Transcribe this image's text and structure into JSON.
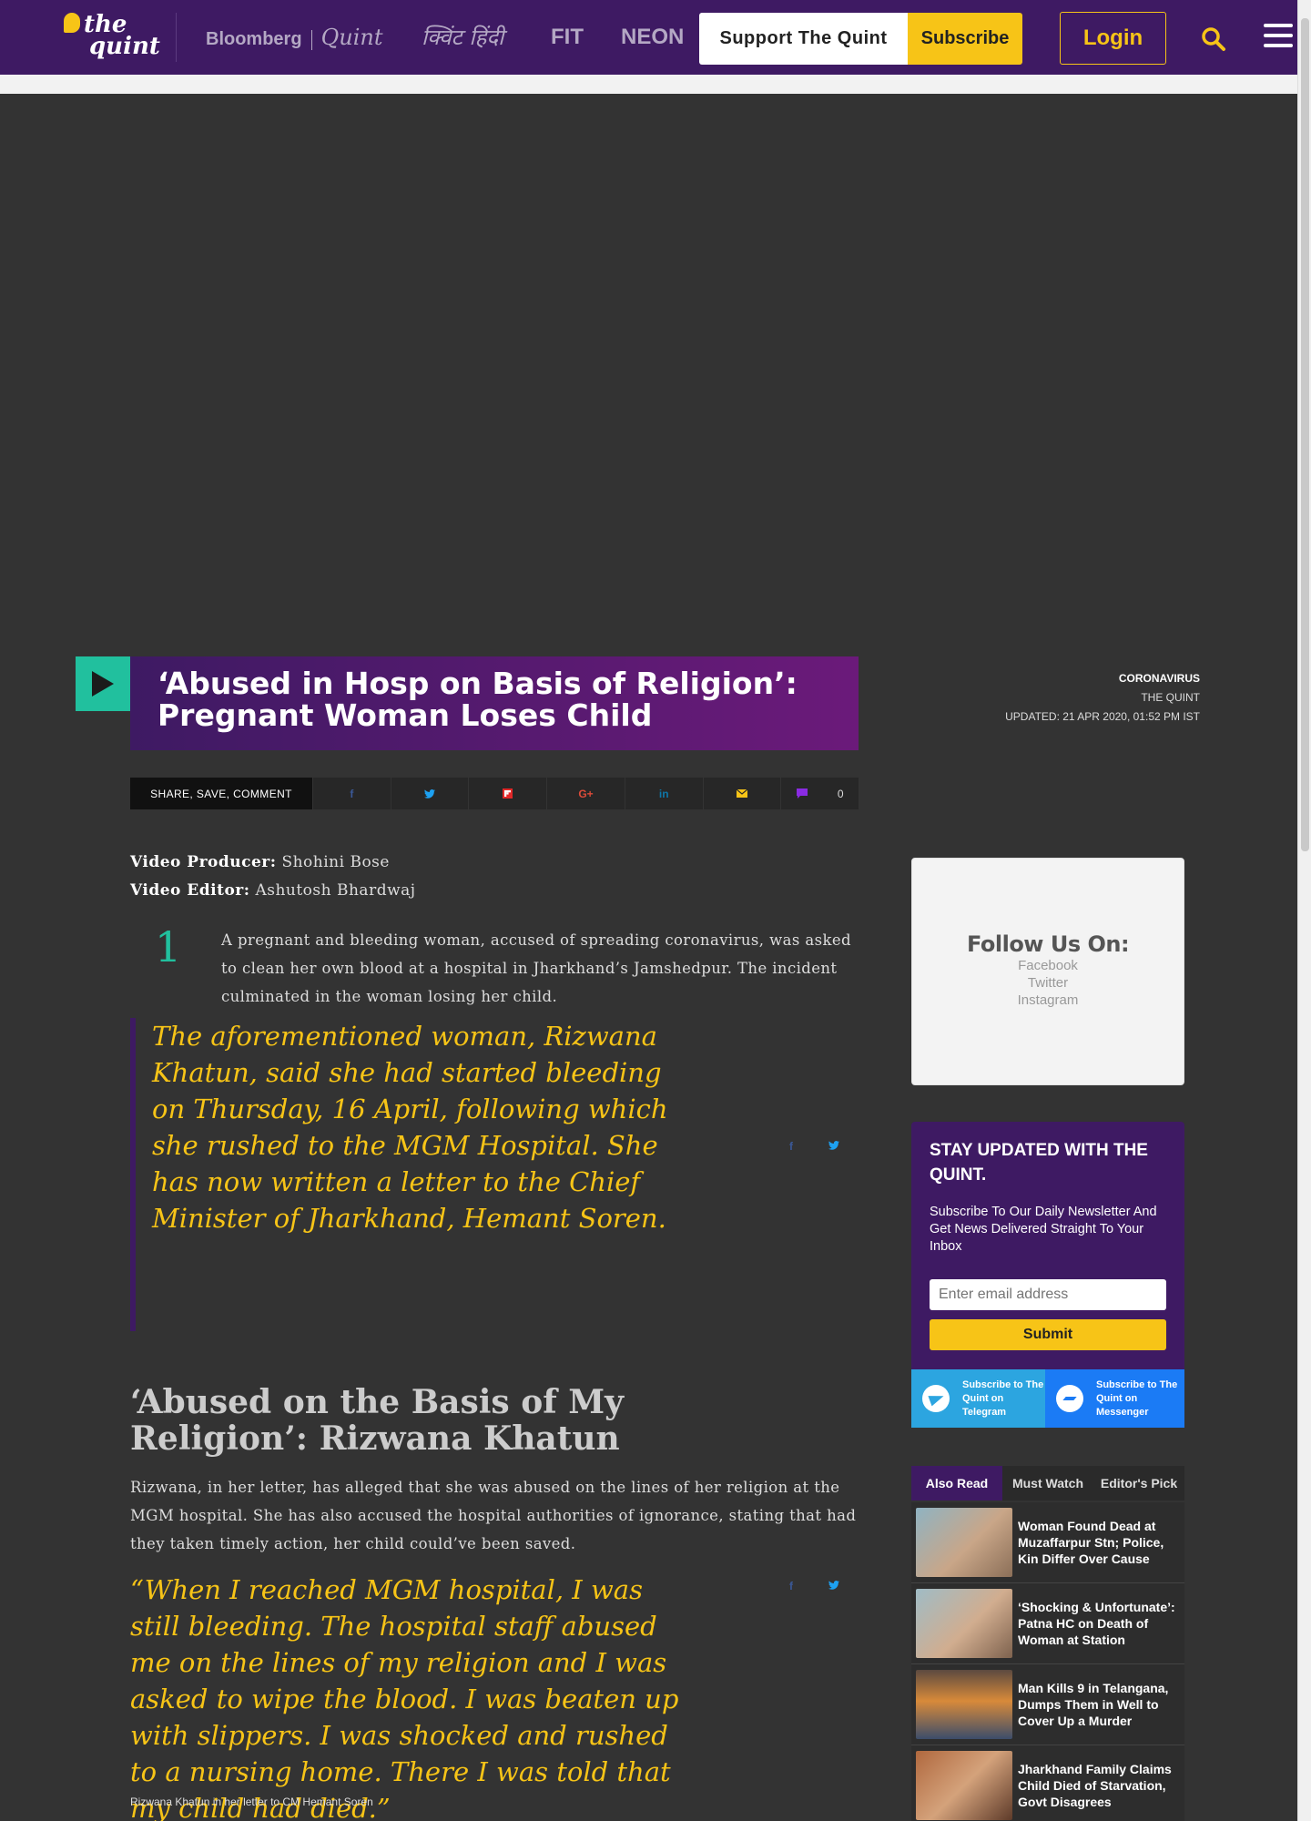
{
  "header": {
    "logo_line1": "the",
    "logo_line2": "quint",
    "brands": {
      "bloomberg": "Bloomberg",
      "quint": "Quint",
      "hindi": "क्विंट हिंदी",
      "fit": "FIT",
      "neon": "NEON"
    },
    "support_label": "Support The Quint",
    "subscribe_label": "Subscribe",
    "login_label": "Login",
    "colors": {
      "bar": "#3e1a63",
      "accent": "#f7c417"
    }
  },
  "article": {
    "title": "‘Abused in Hosp on Basis of Religion’: Pregnant Woman Loses Child",
    "category": "CORONAVIRUS",
    "source": "THE QUINT",
    "updated": "UPDATED: 21 APR 2020, 01:52 PM IST",
    "share": {
      "label": "SHARE, SAVE, COMMENT",
      "comment_count": "0"
    },
    "credits": [
      {
        "role": "Video Producer:",
        "name": "Shohini Bose"
      },
      {
        "role": "Video Editor:",
        "name": "Ashutosh Bhardwaj"
      }
    ],
    "dropcap_number": "1",
    "para1": "A pregnant and bleeding woman, accused of spreading coronavirus, was asked to clean her own blood at a hospital in Jharkhand’s Jamshedpur. The incident culminated in the woman losing her child.",
    "quote1": "The aforementioned woman, Rizwana Khatun, said she had started bleeding on Thursday, 16 April, following which she rushed to the MGM Hospital. She has now written a letter to the Chief Minister of Jharkhand, Hemant Soren.",
    "subheading": "‘Abused on the Basis of My Religion’: Rizwana Khatun",
    "para2": "Rizwana, in her letter, has alleged that she was abused on the lines of her religion at the MGM hospital. She has also accused the hospital authorities of ignorance, stating that had they taken timely action, her child could’ve been saved.",
    "quote2": "“When I reached MGM hospital, I was still bleeding. The hospital staff abused me on the lines of my religion and I was asked to wipe the blood. I was beaten up with slippers. I was shocked and rushed to a nursing home. There I was told that my child had died.”",
    "quote2_caption": "Rizwana Khatun in her letter to CM Hemant Soren"
  },
  "sidebar": {
    "follow_title": "Follow Us On:",
    "follow_links": [
      "Facebook",
      "Twitter",
      "Instagram"
    ],
    "newsletter": {
      "title": "STAY UPDATED WITH THE QUINT.",
      "description": "Subscribe To Our Daily Newsletter And Get News Delivered Straight To Your Inbox",
      "email_placeholder": "Enter email address",
      "submit_label": "Submit"
    },
    "telegram_label": "Subscribe to The Quint on Telegram",
    "messenger_label": "Subscribe to The Quint on Messenger",
    "tabs": [
      "Also Read",
      "Must Watch",
      "Editor's Pick"
    ],
    "list": [
      {
        "title": "Woman Found Dead at Muzaffarpur Stn; Police, Kin Differ Over Cause"
      },
      {
        "title": "‘Shocking & Unfortunate’: Patna HC on Death of Woman at Station"
      },
      {
        "title": "Man Kills 9 in Telangana, Dumps Them in Well to Cover Up a Murder"
      },
      {
        "title": "Jharkhand Family Claims Child Died of Starvation, Govt Disagrees"
      }
    ]
  }
}
